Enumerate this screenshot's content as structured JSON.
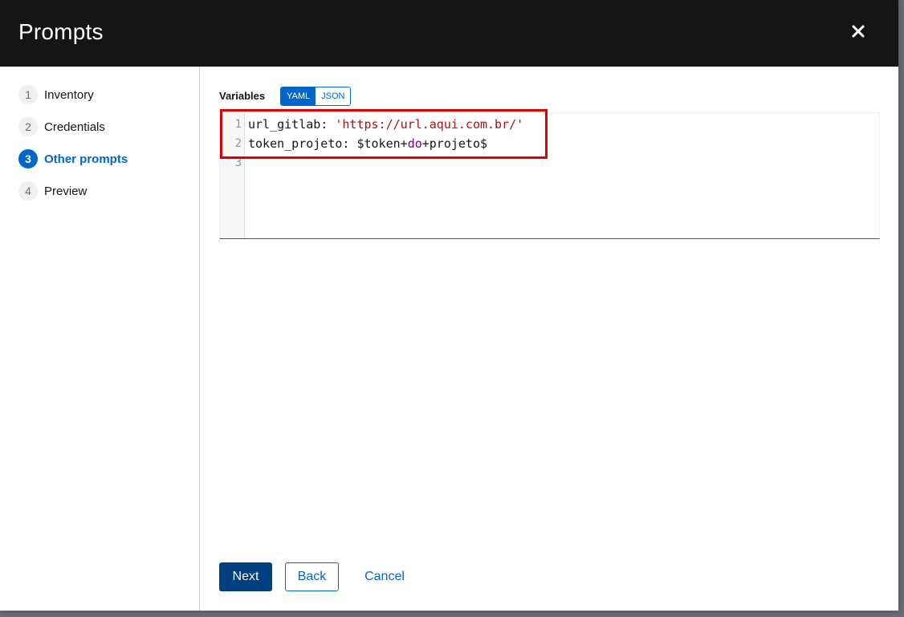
{
  "modal": {
    "title": "Prompts",
    "close_icon": "close-icon"
  },
  "wizard_nav": {
    "steps": [
      {
        "number": "1",
        "label": "Inventory",
        "active": false
      },
      {
        "number": "2",
        "label": "Credentials",
        "active": false
      },
      {
        "number": "3",
        "label": "Other prompts",
        "active": true
      },
      {
        "number": "4",
        "label": "Preview",
        "active": false
      }
    ]
  },
  "variables": {
    "label": "Variables",
    "toggle": {
      "yaml": "YAML",
      "json": "JSON",
      "selected": "YAML"
    }
  },
  "editor": {
    "line_numbers": [
      "1",
      "2",
      "3"
    ],
    "lines": {
      "l1_key": "url_gitlab: ",
      "l1_value": "'https://url.aqui.com.br/'",
      "l2_key": "token_projeto: $token+",
      "l2_kw": "do",
      "l2_rest": "+projeto$",
      "l3": ""
    }
  },
  "footer": {
    "next": "Next",
    "back": "Back",
    "cancel": "Cancel"
  },
  "colors": {
    "header_bg": "#151515",
    "accent": "#0066cc",
    "primary_button": "#004080",
    "highlight": "#e00000"
  }
}
